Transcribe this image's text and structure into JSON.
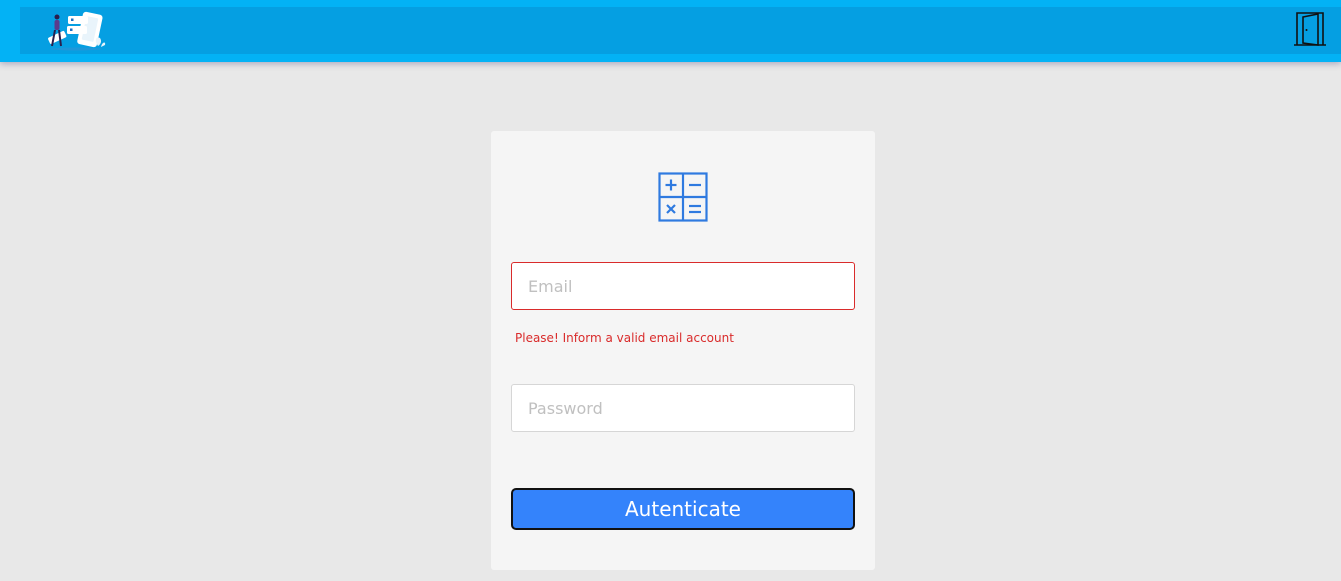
{
  "colors": {
    "header": "#03b2f5",
    "header_inner": "#059fe2",
    "background": "#e8e8e8",
    "card": "#f5f5f5",
    "primary_button": "#3483fb",
    "error": "#d92b2b",
    "icon": "#2f7ae0"
  },
  "header": {
    "logo_icon": "app-logo-illustration",
    "exit_icon": "door-exit-icon"
  },
  "login": {
    "icon": "calculator-icon",
    "email": {
      "placeholder": "Email",
      "value": "",
      "error": "Please! Inform a valid email account"
    },
    "password": {
      "placeholder": "Password",
      "value": ""
    },
    "submit_label": "Autenticate"
  }
}
